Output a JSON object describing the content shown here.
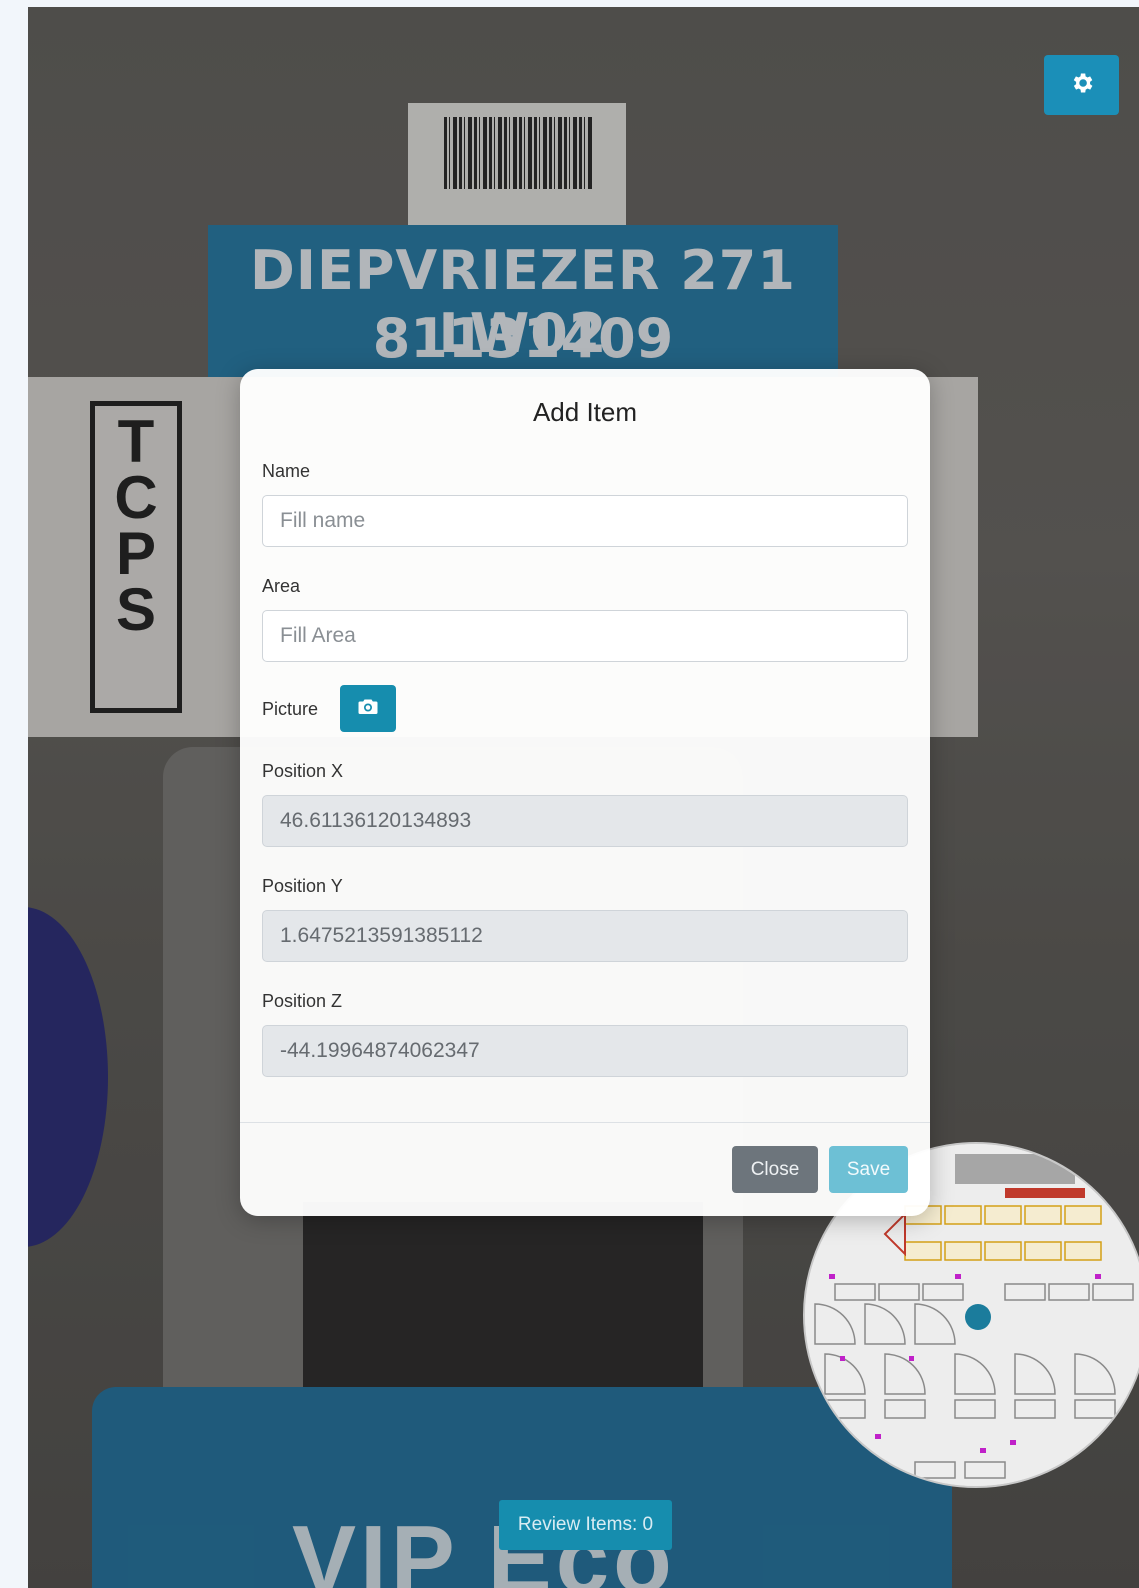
{
  "background": {
    "freezer_label_line1": "DIEPVRIEZER 271 LW02",
    "freezer_label_line2": "81131409",
    "tcps_text": "TCPS",
    "bottom_sign_text": "VIP Eco"
  },
  "settings": {
    "icon": "gear-icon"
  },
  "modal": {
    "title": "Add Item",
    "name_label": "Name",
    "name_placeholder": "Fill name",
    "area_label": "Area",
    "area_placeholder": "Fill Area",
    "picture_label": "Picture",
    "picture_icon": "camera-icon",
    "position_x_label": "Position X",
    "position_x_value": "46.61136120134893",
    "position_y_label": "Position Y",
    "position_y_value": "1.6475213591385112",
    "position_z_label": "Position Z",
    "position_z_value": "-44.19964874062347",
    "close_label": "Close",
    "save_label": "Save"
  },
  "review": {
    "label": "Review Items: 0"
  },
  "colors": {
    "accent": "#168dae",
    "close_button": "#6d757c",
    "save_button": "#6dc0d5"
  }
}
